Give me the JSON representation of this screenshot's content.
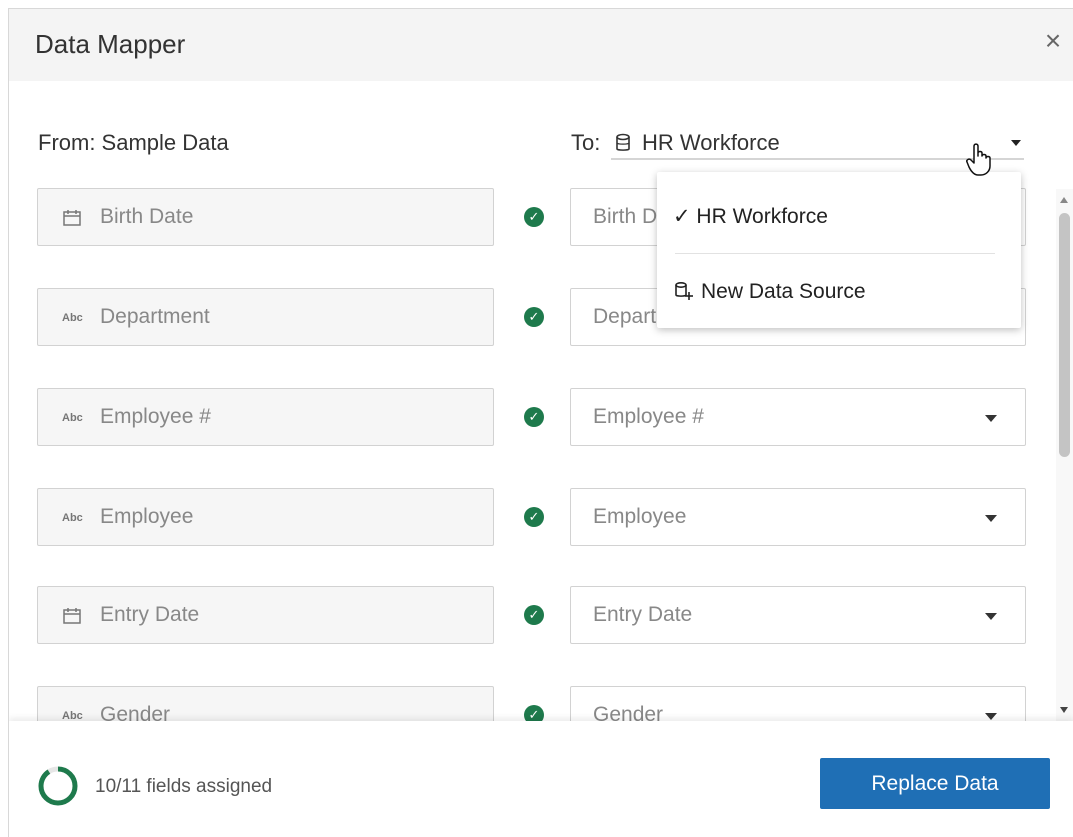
{
  "dialog": {
    "title": "Data Mapper",
    "close_symbol": "×"
  },
  "from": {
    "label": "From: Sample Data"
  },
  "to": {
    "label": "To:",
    "selected": "HR Workforce"
  },
  "dropdown": {
    "items": [
      {
        "label": "✓ HR Workforce",
        "icon": "checkmark"
      },
      {
        "label": "New Data Source",
        "icon": "new-data-source-icon"
      }
    ]
  },
  "rows": [
    {
      "field": "Birth Date",
      "field_icon": "calendar-icon",
      "target": "Birth Date"
    },
    {
      "field": "Department",
      "field_icon": "Abc",
      "target": "Department"
    },
    {
      "field": "Employee #",
      "field_icon": "Abc",
      "target": "Employee #"
    },
    {
      "field": "Employee",
      "field_icon": "Abc",
      "target": "Employee"
    },
    {
      "field": "Entry Date",
      "field_icon": "calendar-icon",
      "target": "Entry Date"
    },
    {
      "field": "Gender",
      "field_icon": "Abc",
      "target": "Gender"
    }
  ],
  "footer": {
    "progress_text": "10/11 fields assigned",
    "progress_fraction": 0.909,
    "replace_button": "Replace Data"
  },
  "colors": {
    "accent": "#1f6fb5",
    "check": "#1e7a4c",
    "progress": "#1e7a4c"
  }
}
